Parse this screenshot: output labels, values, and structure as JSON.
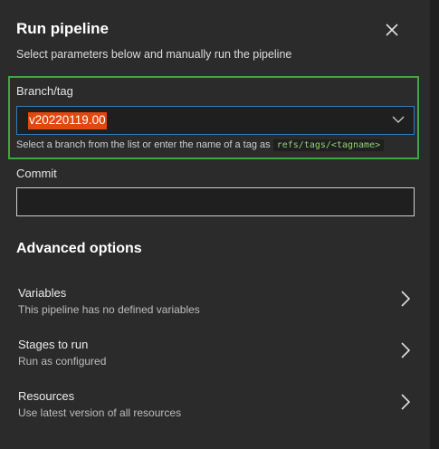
{
  "dialog": {
    "title": "Run pipeline",
    "subtitle": "Select parameters below and manually run the pipeline"
  },
  "branch": {
    "label": "Branch/tag",
    "value": "v20220119.00",
    "hint_text": "Select a branch from the list or enter the name of a tag as ",
    "hint_code": "refs/tags/<tagname>"
  },
  "commit": {
    "label": "Commit",
    "value": ""
  },
  "advanced": {
    "heading": "Advanced options",
    "options": [
      {
        "title": "Variables",
        "description": "This pipeline has no defined variables"
      },
      {
        "title": "Stages to run",
        "description": "Run as configured"
      },
      {
        "title": "Resources",
        "description": "Use latest version of all resources"
      }
    ]
  },
  "icons": {
    "close": "close-icon",
    "dropdown": "chevron-down-icon",
    "option_arrow": "chevron-right-icon"
  },
  "colors": {
    "background": "#2b2b2b",
    "input_background": "#1f1f1f",
    "focus_border": "#2f7cc4",
    "highlight_border": "#3fa73f",
    "selection": "#e0480f",
    "code_text": "#8fd46e"
  }
}
